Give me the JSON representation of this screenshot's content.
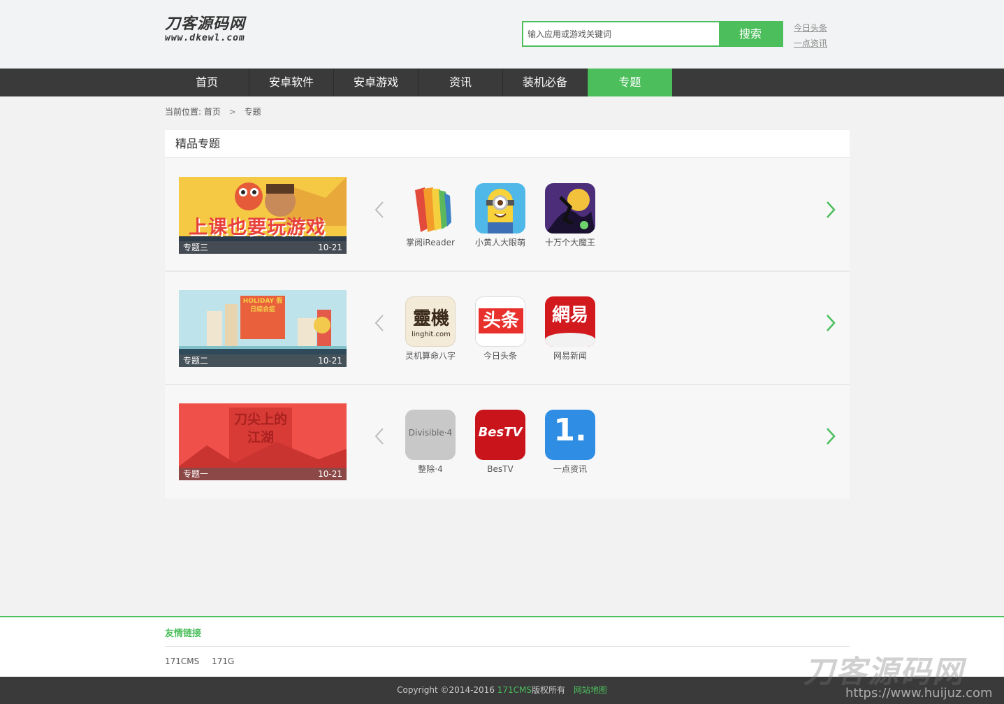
{
  "logo": {
    "main": "刀客源码网",
    "sub": "www.dkewl.com"
  },
  "search": {
    "placeholder": "输入应用或游戏关键词",
    "button": "搜索"
  },
  "hot_links": [
    "今日头条",
    "一点资讯"
  ],
  "nav": [
    {
      "label": "首页"
    },
    {
      "label": "安卓软件"
    },
    {
      "label": "安卓游戏"
    },
    {
      "label": "资讯"
    },
    {
      "label": "装机必备"
    },
    {
      "label": "专题",
      "active": true
    }
  ],
  "breadcrumb": {
    "prefix": "当前位置:",
    "home": "首页",
    "sep": ">",
    "current": "专题"
  },
  "section_title": "精品专题",
  "topics": [
    {
      "banner_text": "上课也要玩游戏",
      "name": "专题三",
      "date": "10-21",
      "apps": [
        {
          "name": "掌阅iReader",
          "icon": "ireader-icon"
        },
        {
          "name": "小黄人大眼萌",
          "icon": "minion-icon"
        },
        {
          "name": "十万个大魔王",
          "icon": "demon-king-icon"
        }
      ]
    },
    {
      "banner_text": "HOLIDAY 假日综合症",
      "name": "专题二",
      "date": "10-21",
      "apps": [
        {
          "name": "灵机算命八字",
          "icon": "linghit-icon",
          "icon_text": "靈機",
          "icon_sub": "linghit.com"
        },
        {
          "name": "今日头条",
          "icon": "toutiao-icon",
          "icon_text": "头条"
        },
        {
          "name": "网易新闻",
          "icon": "netease-icon",
          "icon_text": "網易"
        }
      ]
    },
    {
      "banner_text": "刀尖上的江湖",
      "name": "专题一",
      "date": "10-21",
      "apps": [
        {
          "name": "整除·4",
          "icon": "divisible-icon",
          "icon_text": "Divisible·4"
        },
        {
          "name": "BesTV",
          "icon": "bestv-icon",
          "icon_text": "BesTV"
        },
        {
          "name": "一点资讯",
          "icon": "yidian-icon",
          "icon_text": "1."
        }
      ]
    }
  ],
  "friend_links": {
    "title": "友情链接",
    "items": [
      "171CMS",
      "171G"
    ]
  },
  "footer": {
    "copyright": "Copyright ©2014-2016 ",
    "brand": "171CMS",
    "rights": "版权所有",
    "sitemap": "网站地图"
  },
  "watermark": {
    "text": "刀客源码网",
    "url": "https://www.huijuz.com"
  },
  "colors": {
    "accent": "#4cbe5c",
    "nav_bg": "#3a3a3a"
  }
}
